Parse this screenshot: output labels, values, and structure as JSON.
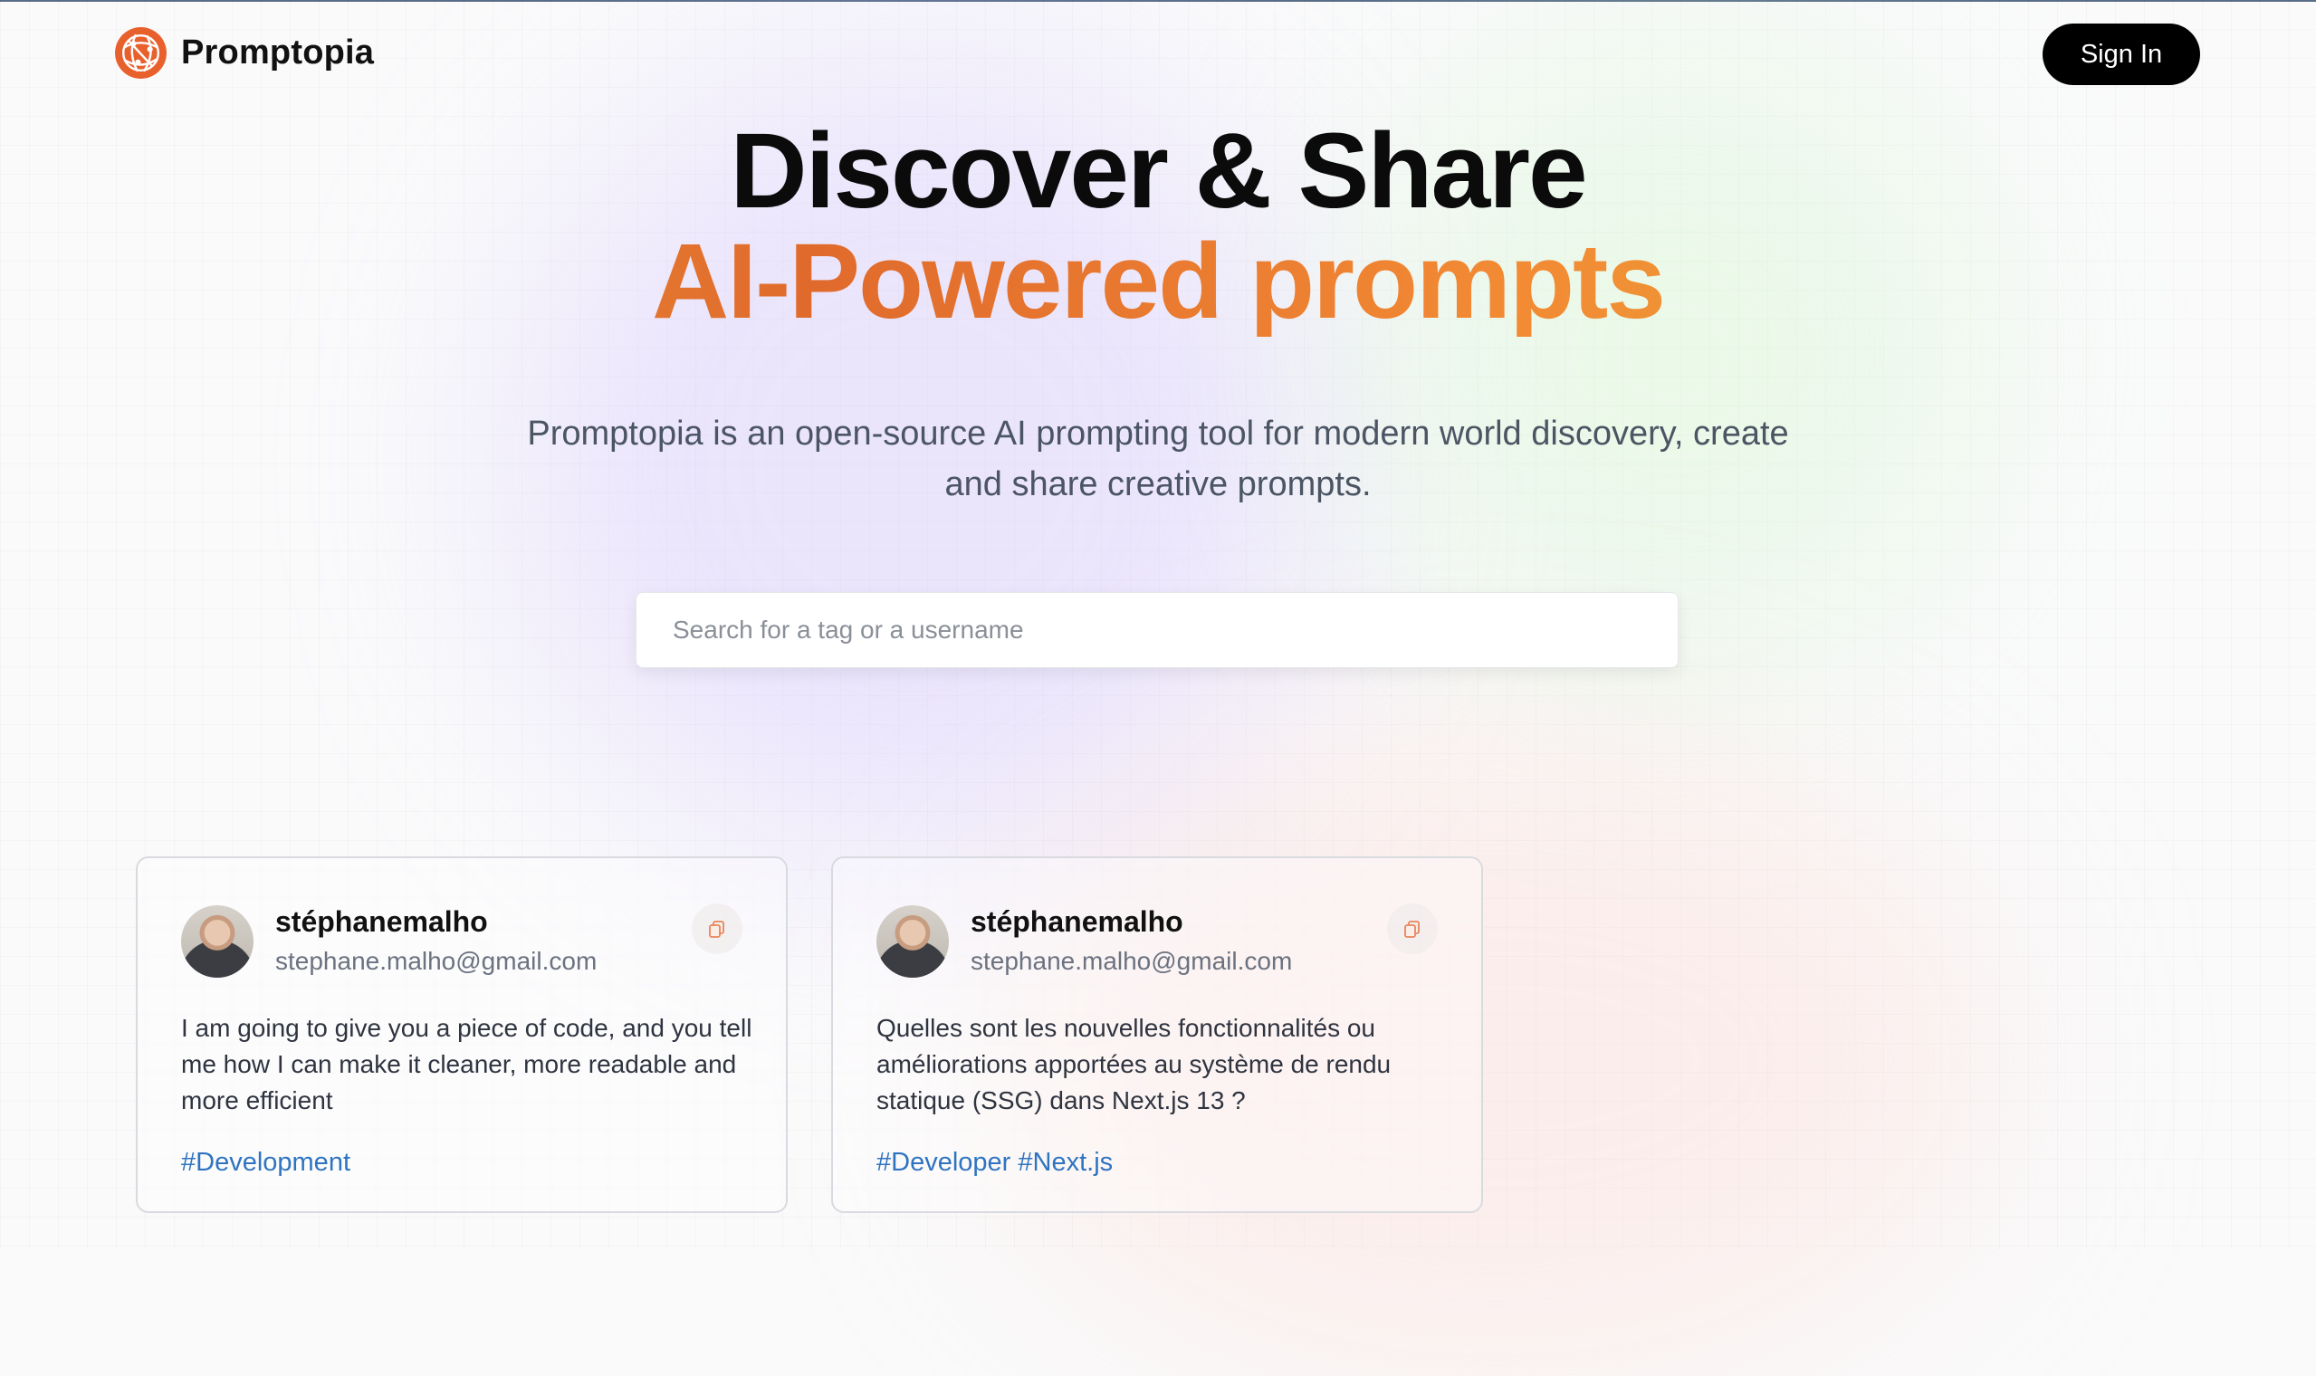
{
  "brand": {
    "name": "Promptopia",
    "icon": "logo-globe-icon",
    "accent_color": "#e8602c"
  },
  "nav": {
    "sign_in_label": "Sign In"
  },
  "hero": {
    "title_line1": "Discover & Share",
    "title_line2": "AI-Powered prompts",
    "description": "Promptopia is an open-source AI prompting tool for modern world discovery, create and share creative prompts.",
    "gradient_colors": [
      "#f0a13b",
      "#e06a2c",
      "#e9b03c"
    ]
  },
  "search": {
    "value": "",
    "placeholder": "Search for a tag or a username"
  },
  "prompts": [
    {
      "username": "stéphanemalho",
      "email": "stephane.malho@gmail.com",
      "text": "I am going to give you a piece of code, and you tell me how I can make it cleaner, more readable and more efficient",
      "tags": [
        "#Development"
      ],
      "copy_icon": "copy-icon"
    },
    {
      "username": "stéphanemalho",
      "email": "stephane.malho@gmail.com",
      "text": "Quelles sont les nouvelles fonctionnalités ou améliorations apportées au système de rendu statique (SSG) dans Next.js 13 ?",
      "tags": [
        "#Developer",
        "#Next.js"
      ],
      "copy_icon": "copy-icon"
    }
  ],
  "colors": {
    "tag": "#2f74c0",
    "button_bg": "#000000"
  }
}
